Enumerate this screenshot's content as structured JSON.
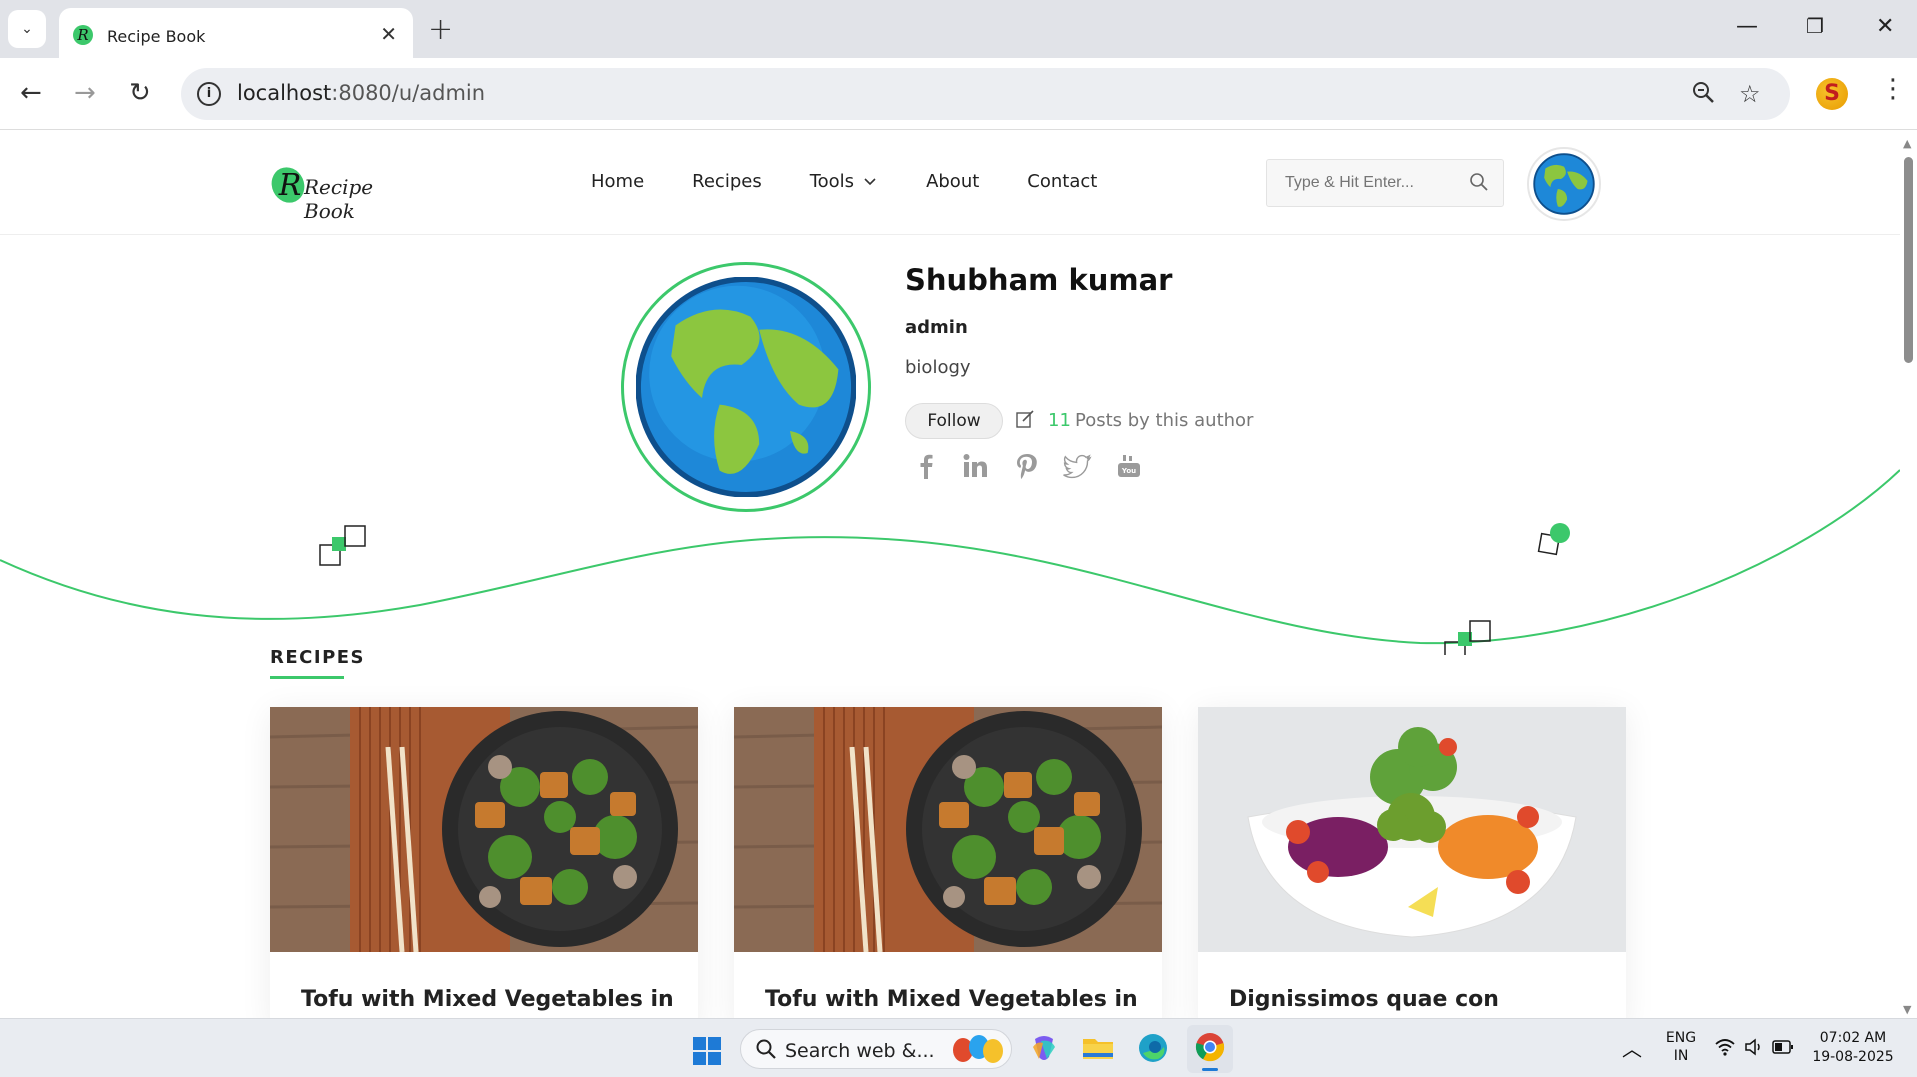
{
  "browser": {
    "tab_title": "Recipe Book",
    "url_host": "localhost",
    "url_rest": ":8080/u/admin",
    "profile_initial": "S"
  },
  "site": {
    "logo_text": "Recipe Book",
    "nav": [
      "Home",
      "Recipes",
      "Tools",
      "About",
      "Contact"
    ],
    "search_placeholder": "Type & Hit Enter..."
  },
  "author": {
    "name": "Shubham kumar",
    "username": "admin",
    "bio": "biology",
    "follow_label": "Follow",
    "posts_count": "11",
    "posts_label": "Posts by this author",
    "social_icons": [
      "facebook-icon",
      "linkedin-icon",
      "pinterest-icon",
      "twitter-icon",
      "youtube-icon"
    ]
  },
  "recipes": {
    "section_title": "RECIPES",
    "cards": [
      {
        "title": "Tofu with Mixed Vegetables in Garlic Sauce",
        "image": "tofu-bowl"
      },
      {
        "title": "Tofu with Mixed Vegetables in Garlic Sauce",
        "image": "tofu-bowl"
      },
      {
        "title": "Dignissimos quae con",
        "image": "salad-bowl"
      }
    ]
  },
  "taskbar": {
    "search_text": "Search web &...",
    "lang_line1": "ENG",
    "lang_line2": "IN",
    "time": "07:02 AM",
    "date": "19-08-2025"
  },
  "colors": {
    "accent": "#3cc86b",
    "tab_bar": "#e1e3e8",
    "omnibox": "#eceef2"
  }
}
